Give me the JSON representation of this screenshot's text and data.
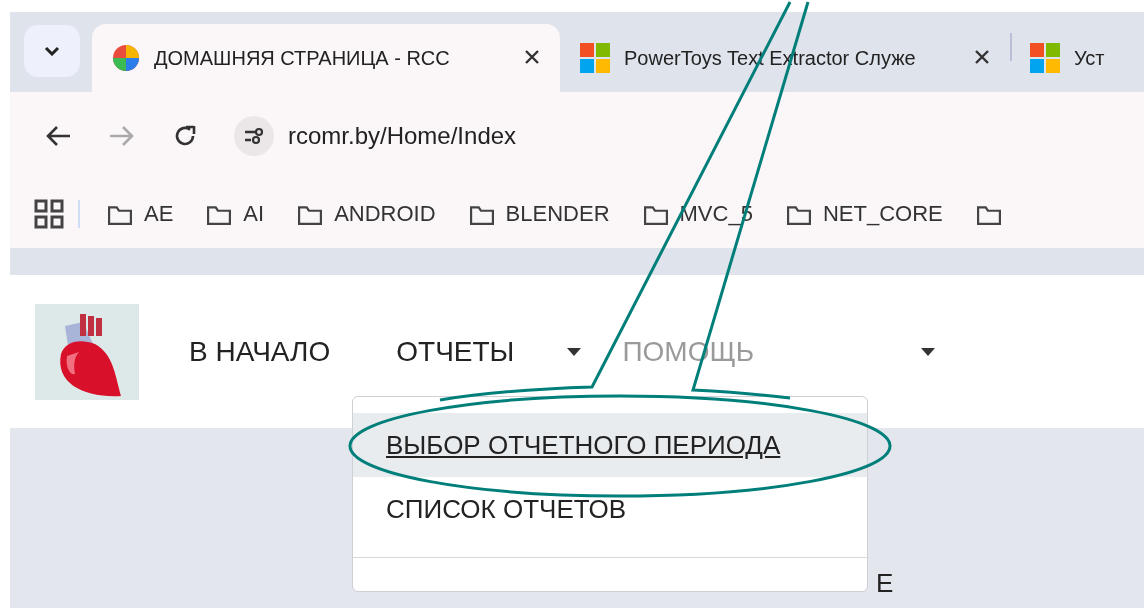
{
  "browser": {
    "tabs": [
      {
        "title": "ДОМАШНЯЯ СТРАНИЦА - RCC",
        "selected": true,
        "closable": true
      },
      {
        "title": "PowerToys Text Extractor Служе",
        "selected": false,
        "closable": true
      },
      {
        "title": "Уст",
        "selected": false,
        "closable": false
      }
    ],
    "toolbar": {
      "back_disabled": false,
      "forward_disabled": true,
      "url": "rcomr.by/Home/Index"
    },
    "bookmarks": [
      {
        "label": "AE"
      },
      {
        "label": "AI"
      },
      {
        "label": "ANDROID"
      },
      {
        "label": "BLENDER"
      },
      {
        "label": "MVC_5"
      },
      {
        "label": "NET_CORE"
      }
    ]
  },
  "page": {
    "nav": [
      {
        "label": "В НАЧАЛО",
        "dropdown": false,
        "disabled": false
      },
      {
        "label": "ОТЧЕТЫ",
        "dropdown": true,
        "disabled": false
      },
      {
        "label": "ПОМОЩЬ",
        "dropdown": true,
        "disabled": true
      }
    ],
    "menu": [
      {
        "label": "ВЫБОР ОТЧЕТНОГО ПЕРИОДА",
        "selected": true
      },
      {
        "label": "СПИСОК ОТЧЕТОВ",
        "selected": false
      }
    ],
    "partial_heading": "E"
  }
}
